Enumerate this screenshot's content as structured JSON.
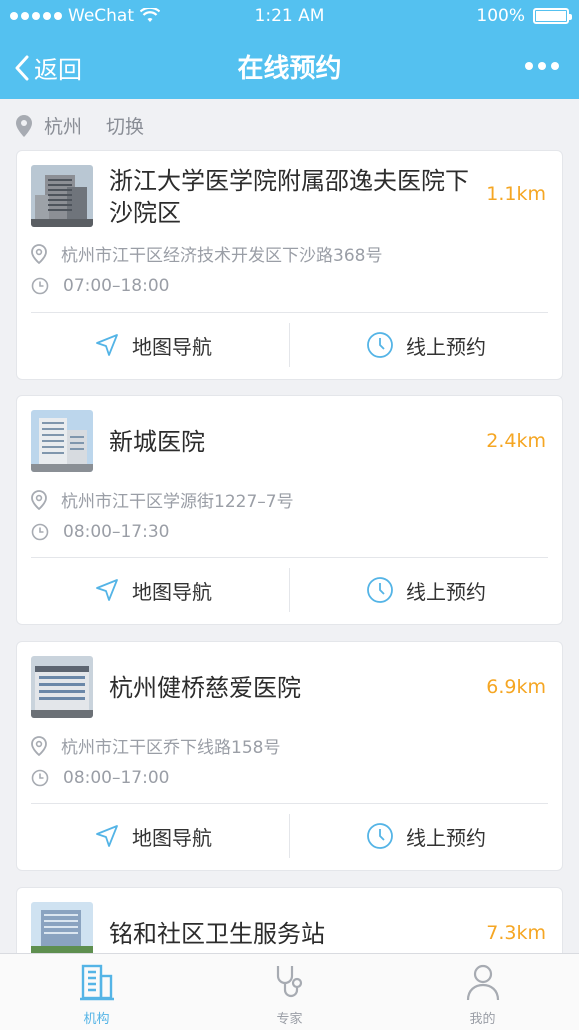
{
  "status_bar": {
    "carrier": "WeChat",
    "time": "1:21 AM",
    "battery": "100%"
  },
  "nav": {
    "back_label": "返回",
    "title": "在线预约"
  },
  "location": {
    "city": "杭州",
    "switch_label": "切换"
  },
  "hospitals": [
    {
      "name": "浙江大学医学院附属邵逸夫医院下沙院区",
      "distance": "1.1km",
      "address": "杭州市江干区经济技术开发区下沙路368号",
      "hours": "07:00–18:00",
      "nav_label": "地图导航",
      "book_label": "线上预约"
    },
    {
      "name": "新城医院",
      "distance": "2.4km",
      "address": "杭州市江干区学源街1227–7号",
      "hours": "08:00–17:30",
      "nav_label": "地图导航",
      "book_label": "线上预约"
    },
    {
      "name": "杭州健桥慈爱医院",
      "distance": "6.9km",
      "address": "杭州市江干区乔下线路158号",
      "hours": "08:00–17:00",
      "nav_label": "地图导航",
      "book_label": "线上预约"
    },
    {
      "name": "铭和社区卫生服务站",
      "distance": "7.3km"
    }
  ],
  "tabs": [
    {
      "label": "机构",
      "icon": "building-icon",
      "active": true
    },
    {
      "label": "专家",
      "icon": "stethoscope-icon",
      "active": false
    },
    {
      "label": "我的",
      "icon": "person-icon",
      "active": false
    }
  ],
  "colors": {
    "accent": "#54c1f0",
    "distance": "#f5a623",
    "tab_active": "#54b4e6"
  }
}
